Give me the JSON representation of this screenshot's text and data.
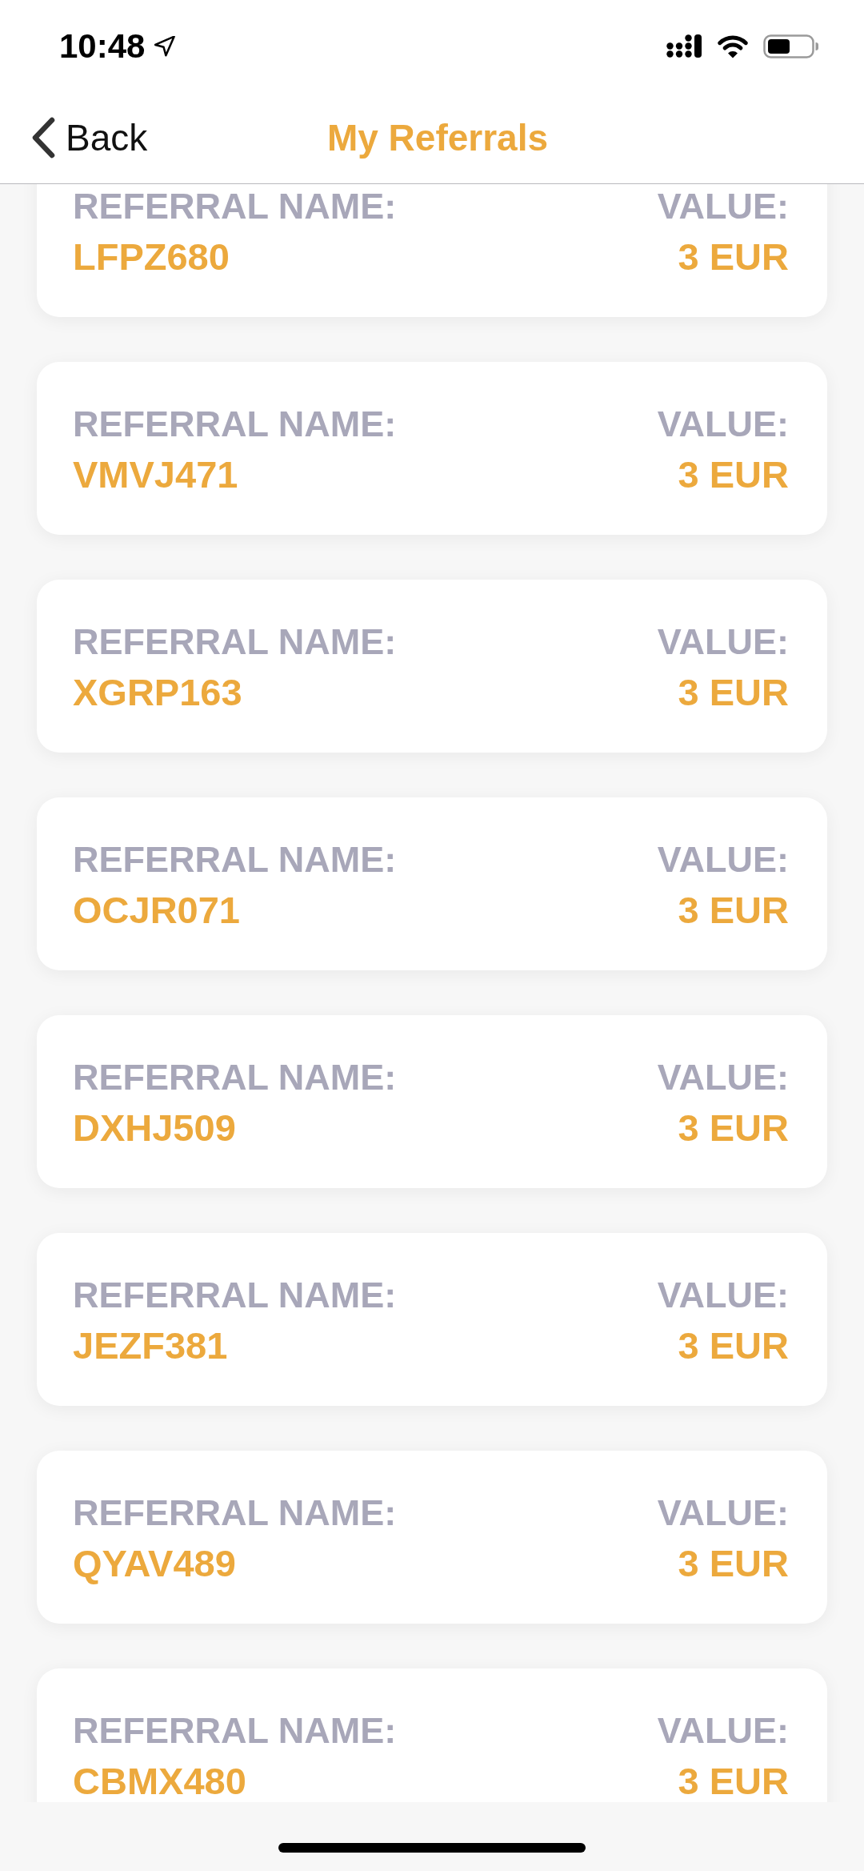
{
  "status_bar": {
    "time": "10:48"
  },
  "nav_bar": {
    "back_label": "Back",
    "title": "My Referrals"
  },
  "referrals": [
    {
      "name_label": "REFERRAL NAME:",
      "name": "LFPZ680",
      "value_label": "VALUE:",
      "value": "3 EUR"
    },
    {
      "name_label": "REFERRAL NAME:",
      "name": "VMVJ471",
      "value_label": "VALUE:",
      "value": "3 EUR"
    },
    {
      "name_label": "REFERRAL NAME:",
      "name": "XGRP163",
      "value_label": "VALUE:",
      "value": "3 EUR"
    },
    {
      "name_label": "REFERRAL NAME:",
      "name": "OCJR071",
      "value_label": "VALUE:",
      "value": "3 EUR"
    },
    {
      "name_label": "REFERRAL NAME:",
      "name": "DXHJ509",
      "value_label": "VALUE:",
      "value": "3 EUR"
    },
    {
      "name_label": "REFERRAL NAME:",
      "name": "JEZF381",
      "value_label": "VALUE:",
      "value": "3 EUR"
    },
    {
      "name_label": "REFERRAL NAME:",
      "name": "QYAV489",
      "value_label": "VALUE:",
      "value": "3 EUR"
    },
    {
      "name_label": "REFERRAL NAME:",
      "name": "CBMX480",
      "value_label": "VALUE:",
      "value": "3 EUR"
    }
  ]
}
